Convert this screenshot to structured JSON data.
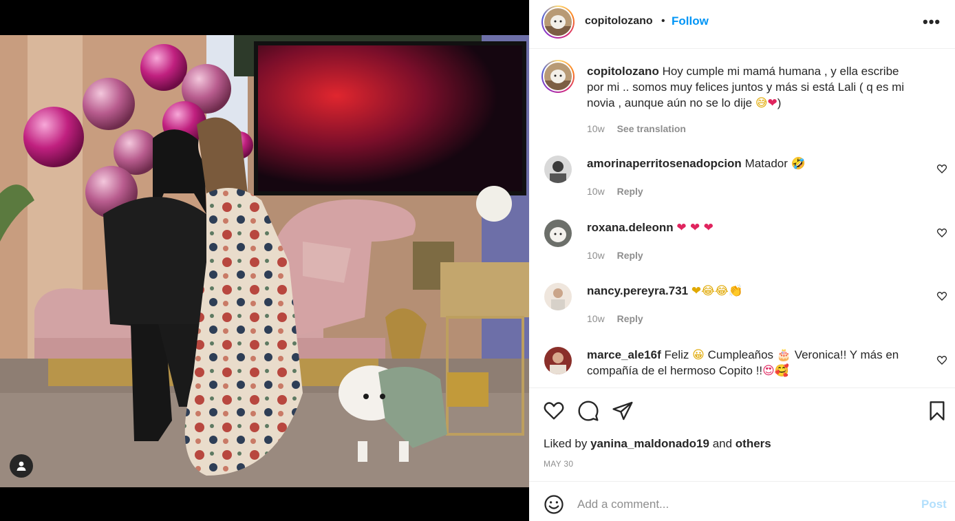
{
  "post": {
    "author": "copitolozano",
    "separator": "•",
    "follow_label": "Follow",
    "more_label": "•••",
    "caption": {
      "username": "copitolozano",
      "text": "Hoy cumple mi mamá humana , y ella escribe por mi .. somos muy felices juntos y más si está Lali ( q es mi novia , aunque aún no se lo dije",
      "emoji_1": "😅",
      "emoji_2": "❤",
      "closing": ")",
      "time": "10w",
      "see_translation": "See translation"
    }
  },
  "comments": [
    {
      "username": "amorinaperritosenadopcion",
      "text": "Matador",
      "emojis": "🤣",
      "time": "10w",
      "reply": "Reply"
    },
    {
      "username": "roxana.deleonn",
      "text": "",
      "emojis": "❤ ❤ ❤",
      "time": "10w",
      "reply": "Reply"
    },
    {
      "username": "nancy.pereyra.731",
      "text": "",
      "emojis": "❤😂😂👏",
      "time": "10w",
      "reply": "Reply"
    },
    {
      "username": "marce_ale16f",
      "text_1": "Feliz",
      "emoji_1": "😀",
      "text_2": "Cumpleaños",
      "emoji_2": "🎂",
      "text_3": "Veronica!! Y más en compañía de el hermoso Copito !!",
      "emoji_3": "😍🥰"
    }
  ],
  "actions": {
    "liked_by_prefix": "Liked by",
    "liked_by_user": "yanina_maldonado19",
    "liked_by_and": "and",
    "liked_by_others": "others",
    "date": "MAY 30"
  },
  "add_comment": {
    "placeholder": "Add a comment...",
    "post_label": "Post"
  },
  "icons": {
    "like": "heart-icon",
    "comment": "comment-icon",
    "share": "share-icon",
    "save": "bookmark-icon",
    "emoji": "emoji-icon",
    "more": "more-options-icon",
    "tagged_user": "tagged-user-icon"
  },
  "colors": {
    "follow_blue": "#0095f6",
    "post_disabled": "#b2dffc",
    "muted": "#8e8e8e",
    "heart_red": "#e0245e"
  }
}
